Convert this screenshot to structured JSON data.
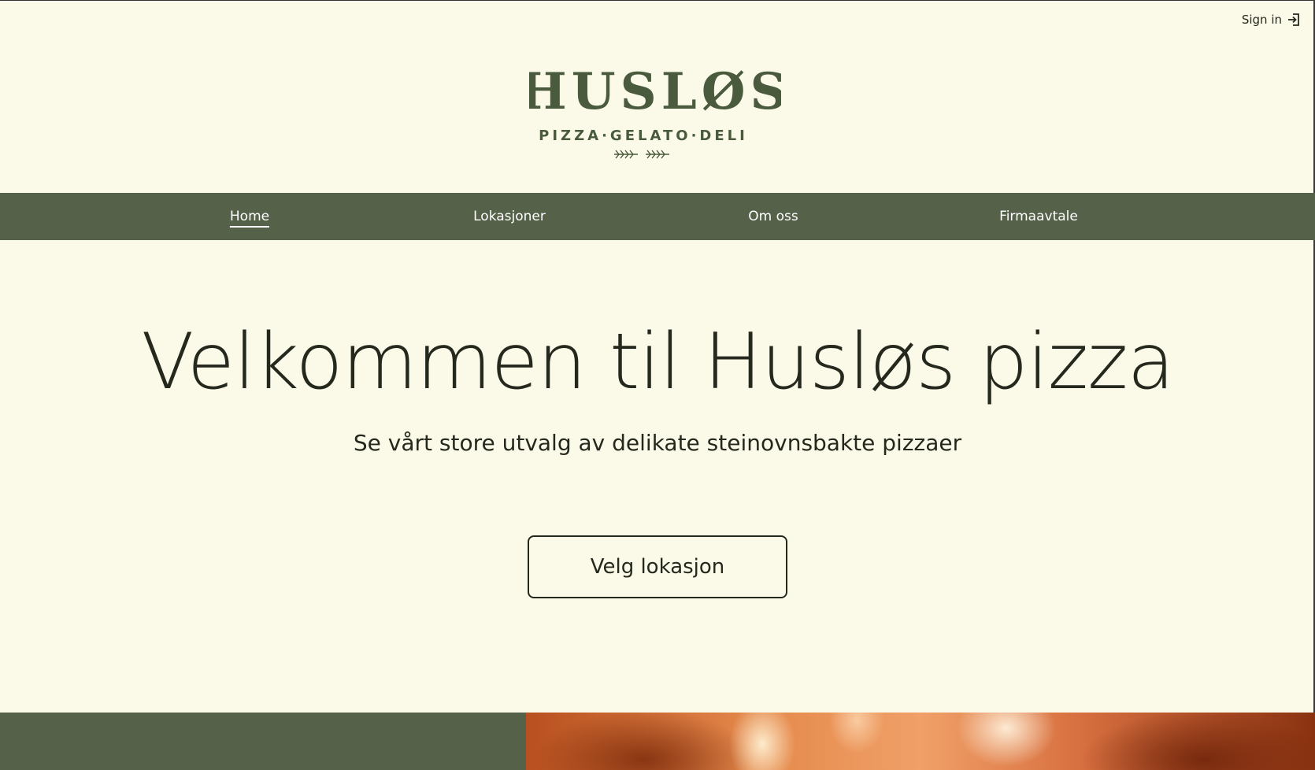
{
  "header": {
    "signin_label": "Sign in",
    "signin_icon": "sign-in-icon",
    "logo": {
      "wordmark": "HUSLØS",
      "tagline": "PIZZA·GELATO·DELI",
      "ornament_icon": "wheat-sprigs-icon"
    }
  },
  "nav": {
    "items": [
      {
        "label": "Home",
        "active": true
      },
      {
        "label": "Lokasjoner",
        "active": false
      },
      {
        "label": "Om oss",
        "active": false
      },
      {
        "label": "Firmaavtale",
        "active": false
      }
    ]
  },
  "hero": {
    "title": "Velkommen til Husløs pizza",
    "subtitle": "Se vårt store utvalg av delikate steinovnsbakte pizzaer",
    "cta_label": "Velg lokasjon"
  },
  "colors": {
    "background": "#fbf9e8",
    "brand_green": "#56614a",
    "text_dark": "#25291d",
    "nav_text": "#ffffff"
  }
}
